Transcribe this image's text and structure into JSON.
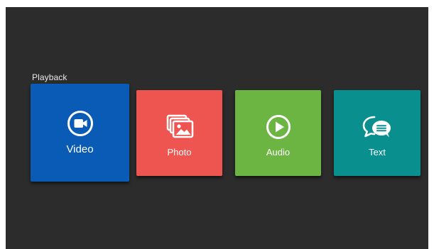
{
  "section": {
    "title": "Playback"
  },
  "tiles": [
    {
      "label": "Video",
      "color": "#0a5bb5",
      "icon": "video-camera-icon"
    },
    {
      "label": "Photo",
      "color": "#ee5550",
      "icon": "photo-gallery-icon"
    },
    {
      "label": "Audio",
      "color": "#6cb543",
      "icon": "play-circle-icon"
    },
    {
      "label": "Text",
      "color": "#0a8f8f",
      "icon": "chat-bubbles-icon"
    }
  ],
  "theme": {
    "background": "#2c2c2c"
  }
}
